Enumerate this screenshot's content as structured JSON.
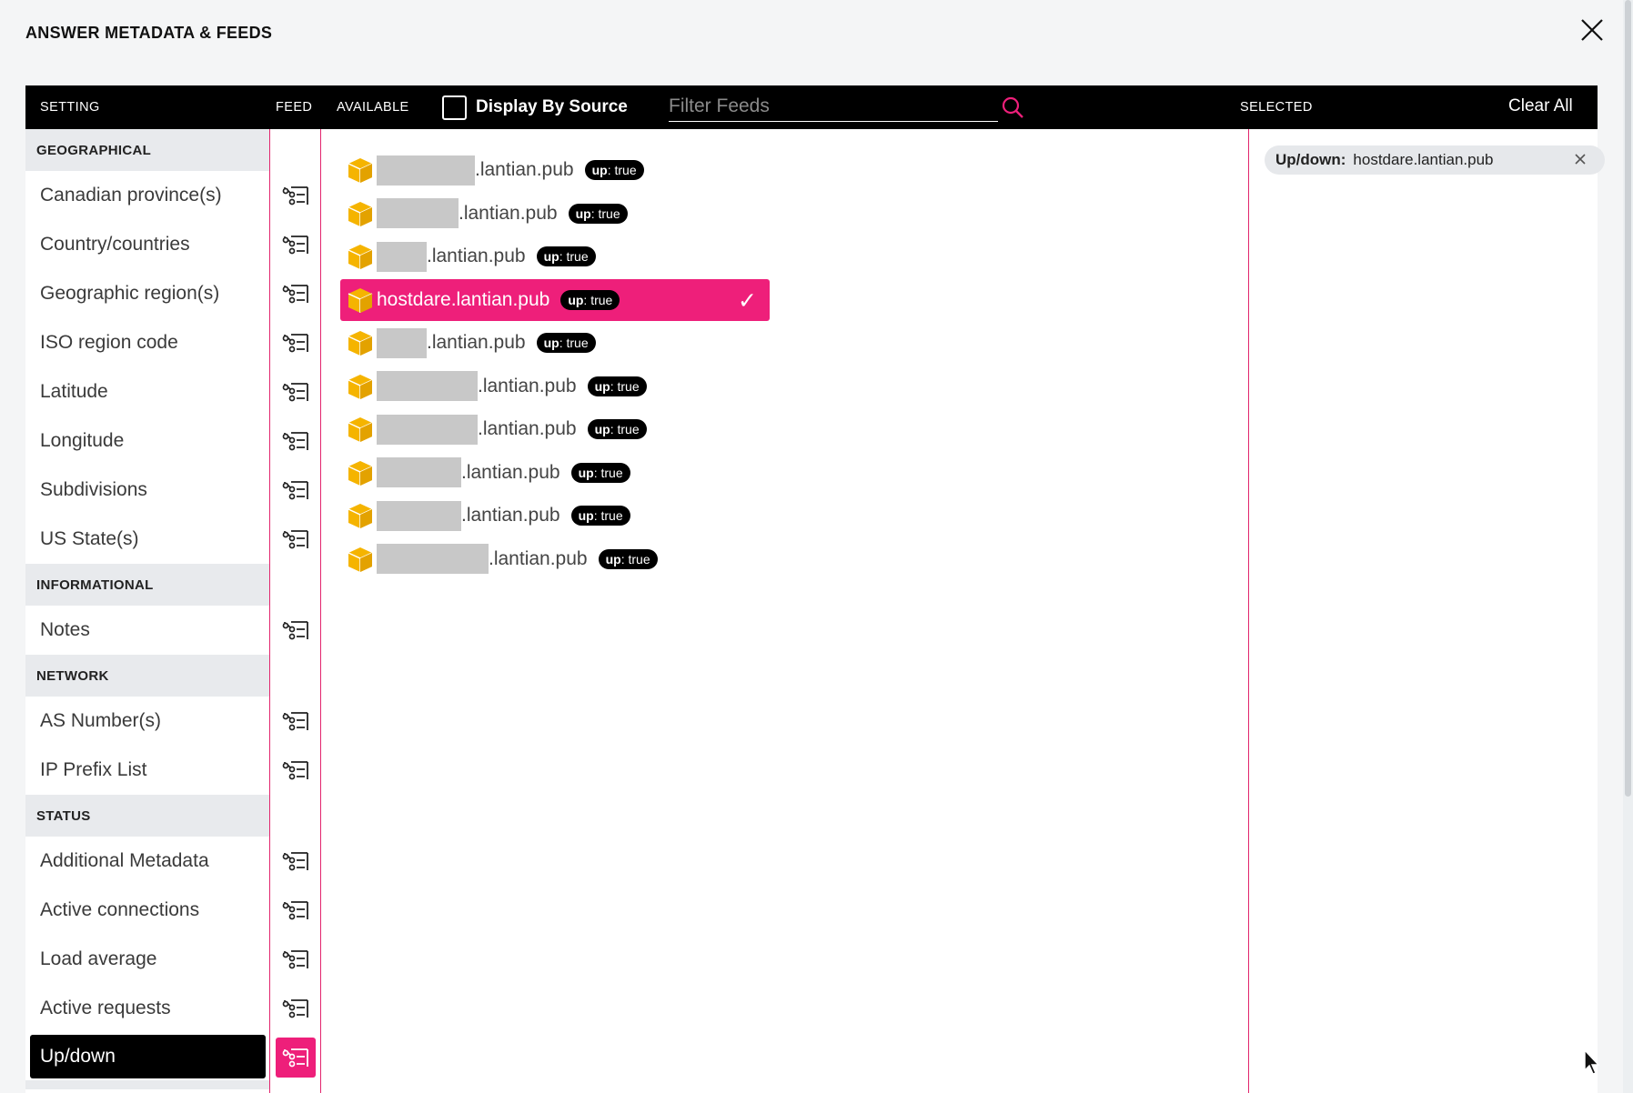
{
  "dialog": {
    "title": "ANSWER METADATA & FEEDS",
    "close_icon": "close-icon"
  },
  "header": {
    "setting": "SETTING",
    "feed": "FEED",
    "available": "AVAILABLE",
    "display_by_source": "Display By Source",
    "display_by_source_checked": false,
    "filter_placeholder": "Filter Feeds",
    "filter_value": "",
    "selected": "SELECTED",
    "clear_all": "Clear All"
  },
  "colors": {
    "accent": "#ee1f7a",
    "header_bg": "#000000",
    "group_bg": "#e8eaed",
    "box_icon": "#f5b400"
  },
  "settings": {
    "groups": [
      {
        "title": "GEOGRAPHICAL",
        "items": [
          {
            "label": "Canadian province(s)"
          },
          {
            "label": "Country/countries"
          },
          {
            "label": "Geographic region(s)"
          },
          {
            "label": "ISO region code"
          },
          {
            "label": "Latitude"
          },
          {
            "label": "Longitude"
          },
          {
            "label": "Subdivisions"
          },
          {
            "label": "US State(s)"
          }
        ]
      },
      {
        "title": "INFORMATIONAL",
        "items": [
          {
            "label": "Notes"
          }
        ]
      },
      {
        "title": "NETWORK",
        "items": [
          {
            "label": "AS Number(s)"
          },
          {
            "label": "IP Prefix List"
          }
        ]
      },
      {
        "title": "STATUS",
        "items": [
          {
            "label": "Additional Metadata"
          },
          {
            "label": "Active connections"
          },
          {
            "label": "Load average"
          },
          {
            "label": "Active requests"
          },
          {
            "label": "Up/down",
            "active": true
          }
        ]
      }
    ]
  },
  "feeds": [
    {
      "name": ".lantian.pub",
      "badge_key": "up",
      "badge_value": ": true",
      "redacted": true,
      "selected": false
    },
    {
      "name": ".lantian.pub",
      "badge_key": "up",
      "badge_value": ": true",
      "redacted": true,
      "selected": false
    },
    {
      "name": ".lantian.pub",
      "badge_key": "up",
      "badge_value": ": true",
      "redacted": true,
      "selected": false
    },
    {
      "name": "hostdare.lantian.pub",
      "badge_key": "up",
      "badge_value": ": true",
      "redacted": false,
      "selected": true
    },
    {
      "name": ".lantian.pub",
      "badge_key": "up",
      "badge_value": ": true",
      "redacted": true,
      "selected": false
    },
    {
      "name": ".lantian.pub",
      "badge_key": "up",
      "badge_value": ": true",
      "redacted": true,
      "selected": false
    },
    {
      "name": ".lantian.pub",
      "badge_key": "up",
      "badge_value": ": true",
      "redacted": true,
      "selected": false
    },
    {
      "name": ".lantian.pub",
      "badge_key": "up",
      "badge_value": ": true",
      "redacted": true,
      "selected": false
    },
    {
      "name": ".lantian.pub",
      "badge_key": "up",
      "badge_value": ": true",
      "redacted": true,
      "selected": false
    },
    {
      "name": ".lantian.pub",
      "badge_key": "up",
      "badge_value": ": true",
      "redacted": true,
      "selected": false
    }
  ],
  "selected_chips": [
    {
      "key": "Up/down:",
      "value": "hostdare.lantian.pub"
    }
  ],
  "checkmark": "✓"
}
